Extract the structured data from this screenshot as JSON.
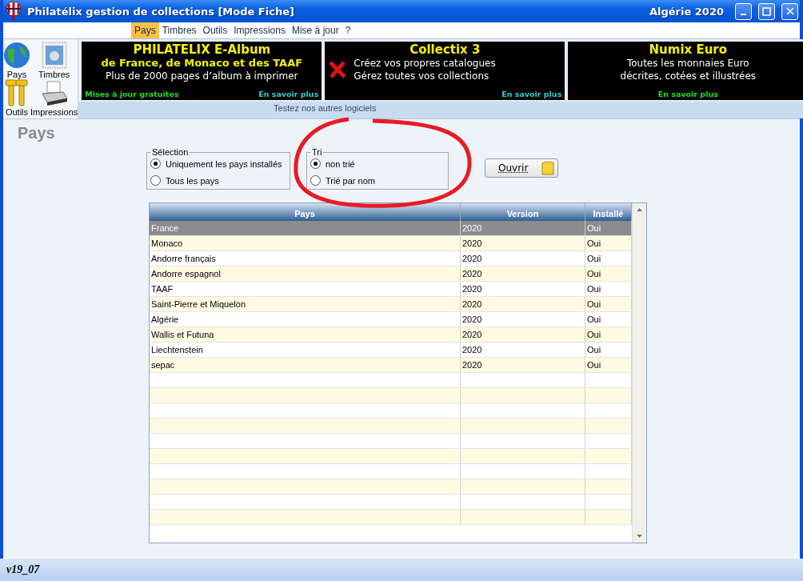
{
  "window": {
    "title": "Philatélix gestion de collections [Mode Fiche]",
    "context": "Algérie 2020"
  },
  "menu": [
    {
      "label": "Pays",
      "selected": true
    },
    {
      "label": "Timbres",
      "selected": false
    },
    {
      "label": "Outils",
      "selected": false
    },
    {
      "label": "Impressions",
      "selected": false
    },
    {
      "label": "Mise à jour",
      "selected": false
    },
    {
      "label": "?",
      "selected": false
    }
  ],
  "toolbar": [
    {
      "label": "Pays",
      "kind": "globe"
    },
    {
      "label": "Timbres",
      "kind": "stamp"
    },
    {
      "label": "Outils",
      "kind": "tools"
    },
    {
      "label": "Impressions",
      "kind": "printer"
    }
  ],
  "ads": [
    {
      "title": "PHILATELIX E-Album",
      "subtitle": "de France, de Monaco et des TAAF",
      "lines": [
        "Plus de 2000 pages d’album à imprimer"
      ],
      "note": "Mises à jour gratuites",
      "link": {
        "label": "En savoir plus",
        "color": "#33cccc"
      },
      "cross": false
    },
    {
      "title": "Collectix 3",
      "lines": [
        "Créez vos propres catalogues",
        "Gérez toutes vos collections"
      ],
      "link": {
        "label": "En savoir plus",
        "color": "#33cccc"
      },
      "cross": true
    },
    {
      "title": "Numix Euro",
      "lines": [
        "Toutes les monnaies Euro",
        "décrites, cotées et illustrées"
      ],
      "link": {
        "label": "En savoir plus",
        "color": "#22dd22"
      },
      "cross": false
    }
  ],
  "ads_caption": "Testez nos autres logiciels",
  "page_title": "Pays",
  "groups": [
    {
      "legend": "Sélection",
      "options": [
        {
          "label": "Uniquement les pays installés",
          "selected": true
        },
        {
          "label": "Tous les pays",
          "selected": false
        }
      ]
    },
    {
      "legend": "Tri",
      "options": [
        {
          "label": "non trié",
          "selected": true
        },
        {
          "label": "Trié par nom",
          "selected": false
        }
      ]
    }
  ],
  "open_button": {
    "label": "Ouvrir"
  },
  "table": {
    "columns": [
      "Pays",
      "Version",
      "Installé"
    ],
    "rows": [
      {
        "cells": [
          "France",
          "2020",
          "Oui"
        ],
        "selected": true
      },
      {
        "cells": [
          "Monaco",
          "2020",
          "Oui"
        ],
        "selected": false
      },
      {
        "cells": [
          "Andorre français",
          "2020",
          "Oui"
        ],
        "selected": false
      },
      {
        "cells": [
          "Andorre espagnol",
          "2020",
          "Oui"
        ],
        "selected": false
      },
      {
        "cells": [
          "TAAF",
          "2020",
          "Oui"
        ],
        "selected": false
      },
      {
        "cells": [
          "Saint-Pierre et Miquelon",
          "2020",
          "Oui"
        ],
        "selected": false
      },
      {
        "cells": [
          "Algérie",
          "2020",
          "Oui"
        ],
        "selected": false
      },
      {
        "cells": [
          "Wallis et Futuna",
          "2020",
          "Oui"
        ],
        "selected": false
      },
      {
        "cells": [
          "Liechtenstein",
          "2020",
          "Oui"
        ],
        "selected": false
      },
      {
        "cells": [
          "sepac",
          "2020",
          "Oui"
        ],
        "selected": false
      }
    ]
  },
  "status_bar": {
    "version": "v19_07"
  }
}
